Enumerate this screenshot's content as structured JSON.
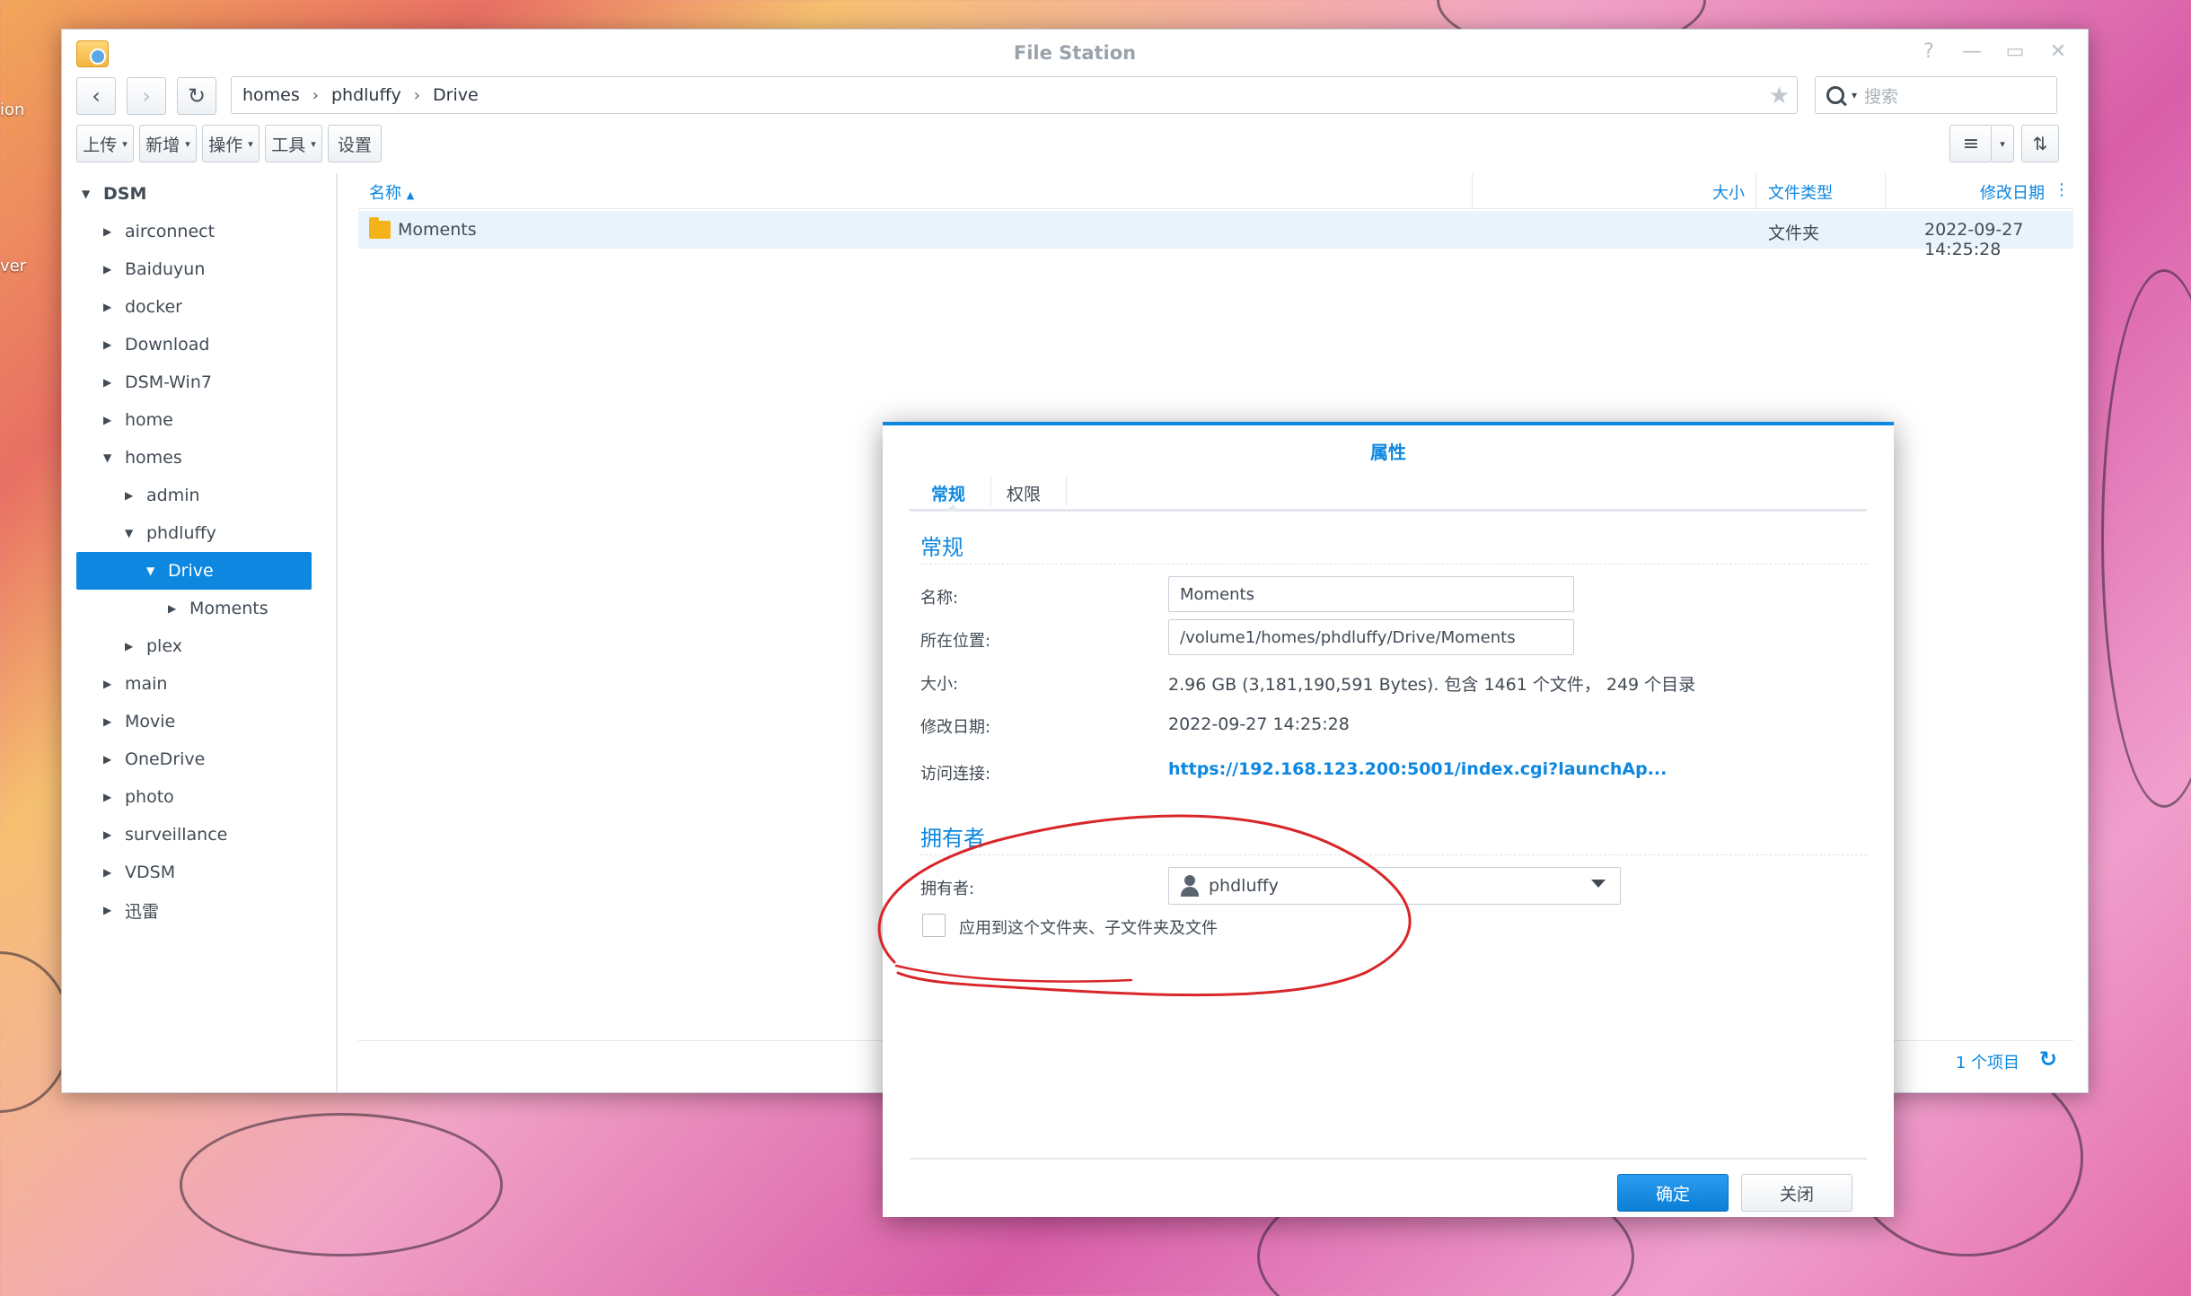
{
  "desktop": {
    "edge_labels": [
      "ion",
      "ver"
    ]
  },
  "window": {
    "title": "File Station",
    "controls": [
      "?",
      "—",
      "▭",
      "✕"
    ],
    "nav": {
      "back_icon": "‹",
      "forward_icon": "›",
      "refresh_icon": "↻"
    },
    "breadcrumb": [
      "homes",
      "phdluffy",
      "Drive"
    ],
    "search_placeholder": "搜索",
    "toolbar": [
      {
        "label": "上传",
        "dropdown": true
      },
      {
        "label": "新增",
        "dropdown": true
      },
      {
        "label": "操作",
        "dropdown": true
      },
      {
        "label": "工具",
        "dropdown": true
      },
      {
        "label": "设置",
        "dropdown": false
      }
    ]
  },
  "tree": {
    "root": "DSM",
    "items": [
      {
        "label": "airconnect",
        "expanded": false
      },
      {
        "label": "Baiduyun",
        "expanded": false
      },
      {
        "label": "docker",
        "expanded": false
      },
      {
        "label": "Download",
        "expanded": false
      },
      {
        "label": "DSM-Win7",
        "expanded": false
      },
      {
        "label": "home",
        "expanded": false
      },
      {
        "label": "homes",
        "expanded": true
      },
      {
        "label": "admin",
        "expanded": false
      },
      {
        "label": "phdluffy",
        "expanded": true
      },
      {
        "label": "Drive",
        "expanded": true
      },
      {
        "label": "Moments",
        "expanded": false
      },
      {
        "label": "plex",
        "expanded": false
      },
      {
        "label": "main",
        "expanded": false
      },
      {
        "label": "Movie",
        "expanded": false
      },
      {
        "label": "OneDrive",
        "expanded": false
      },
      {
        "label": "photo",
        "expanded": false
      },
      {
        "label": "surveillance",
        "expanded": false
      },
      {
        "label": "VDSM",
        "expanded": false
      },
      {
        "label": "迅雷",
        "expanded": false
      }
    ],
    "selected": "Drive"
  },
  "file_list": {
    "columns": {
      "name": "名称",
      "size": "大小",
      "type": "文件类型",
      "modified": "修改日期"
    },
    "rows": [
      {
        "name": "Moments",
        "size": "",
        "type": "文件夹",
        "modified": "2022-09-27 14:25:28"
      }
    ],
    "footer": {
      "count_label": "1 个项目"
    }
  },
  "dialog": {
    "title": "属性",
    "tabs": [
      "常规",
      "权限"
    ],
    "active_tab": "常规",
    "general": {
      "section_title": "常规",
      "name_label": "名称:",
      "name_value": "Moments",
      "location_label": "所在位置:",
      "location_value": "/volume1/homes/phdluffy/Drive/Moments",
      "size_label": "大小:",
      "size_value": "2.96 GB (3,181,190,591 Bytes). 包含 1461 个文件， 249 个目录",
      "modified_label": "修改日期:",
      "modified_value": "2022-09-27 14:25:28",
      "link_label": "访问连接:",
      "link_value": "https://192.168.123.200:5001/index.cgi?launchAp..."
    },
    "owner": {
      "section_title": "拥有者",
      "owner_label": "拥有者:",
      "owner_value": "phdluffy",
      "apply_label": "应用到这个文件夹、子文件夹及文件"
    },
    "buttons": {
      "ok": "确定",
      "close": "关闭"
    }
  },
  "colors": {
    "accent": "#0d87e0",
    "annotation": "#d8262a",
    "folder": "#f5b31a"
  }
}
